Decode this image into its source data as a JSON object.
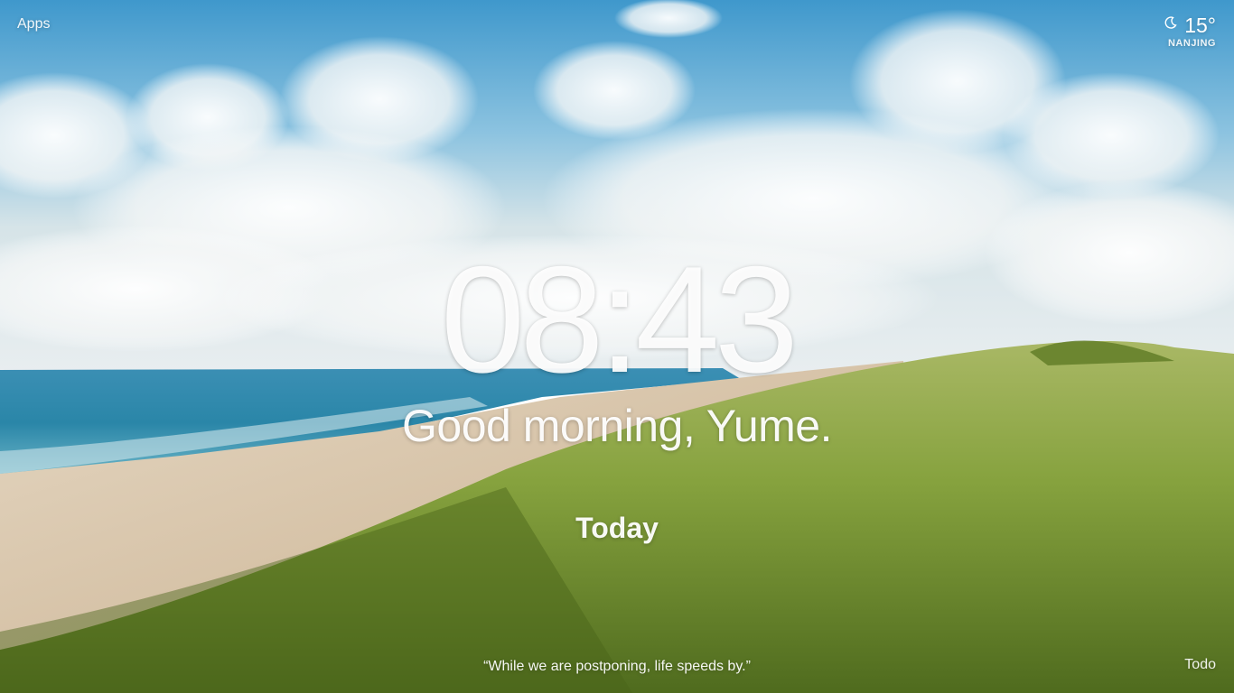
{
  "apps": {
    "label": "Apps"
  },
  "weather": {
    "icon": "moon-icon",
    "temperature": "15°",
    "location": "NANJING"
  },
  "clock": {
    "time": "08:43"
  },
  "greeting": {
    "text": "Good morning, Yume."
  },
  "focus": {
    "label": "Today"
  },
  "quote": {
    "text": "“While we are postponing, life speeds by.”"
  },
  "todo": {
    "label": "Todo"
  },
  "colors": {
    "sky_top": "#4a9fd0",
    "sea": "#2f8fb5",
    "sand": "#d9c7ae",
    "grass": "#7f9f3b"
  }
}
